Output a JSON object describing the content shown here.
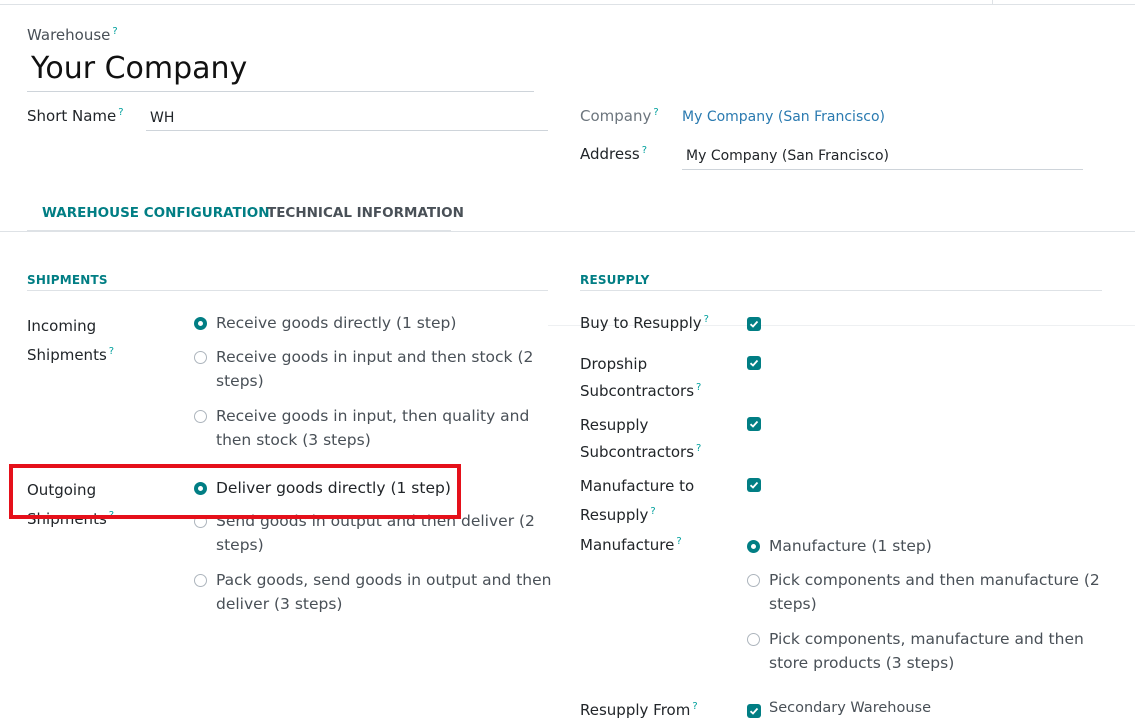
{
  "form": {
    "warehouse_label": "Warehouse",
    "help_mark": "?",
    "warehouse_name": "Your Company",
    "short_name_label": "Short Name",
    "short_name_value": "WH",
    "company_label": "Company",
    "company_value": "My Company (San Francisco)",
    "address_label": "Address",
    "address_value": "My Company (San Francisco)"
  },
  "tabs": [
    {
      "label": "WAREHOUSE CONFIGURATION",
      "active": true
    },
    {
      "label": "TECHNICAL INFORMATION",
      "active": false
    }
  ],
  "shipments": {
    "title": "SHIPMENTS",
    "incoming_label_1": "Incoming",
    "incoming_label_2": "Shipments",
    "incoming_options": [
      {
        "line1": "Receive goods directly (1 step)",
        "line2": "",
        "selected": true
      },
      {
        "line1": "Receive goods in input and then stock (2",
        "line2": "steps)",
        "selected": false
      },
      {
        "line1": "Receive goods in input, then quality and",
        "line2": "then stock (3 steps)",
        "selected": false
      }
    ],
    "outgoing_label_1": "Outgoing",
    "outgoing_label_2": "Shipments",
    "outgoing_options": [
      {
        "line1": "Deliver goods directly (1 step)",
        "line2": "",
        "selected": true
      },
      {
        "line1": "Send goods in output and then deliver (2",
        "line2": "steps)",
        "selected": false
      },
      {
        "line1": "Pack goods, send goods in output and then",
        "line2": "deliver (3 steps)",
        "selected": false
      }
    ]
  },
  "resupply": {
    "title": "RESUPPLY",
    "buy_label": "Buy to Resupply",
    "buy_checked": true,
    "dropship_label_1": "Dropship",
    "dropship_label_2": "Subcontractors",
    "dropship_checked": true,
    "resupply_sub_label_1": "Resupply",
    "resupply_sub_label_2": "Subcontractors",
    "resupply_sub_checked": true,
    "manufacture_to_label_1": "Manufacture to",
    "manufacture_to_label_2": "Resupply",
    "manufacture_to_checked": true,
    "manufacture_label": "Manufacture",
    "manufacture_options": [
      {
        "line1": "Manufacture (1 step)",
        "line2": "",
        "selected": true
      },
      {
        "line1": "Pick components and then manufacture (2",
        "line2": "steps)",
        "selected": false
      },
      {
        "line1": "Pick components, manufacture and then",
        "line2": "store products (3 steps)",
        "selected": false
      }
    ],
    "resupply_from_label": "Resupply From",
    "resupply_from_value": "Secondary Warehouse",
    "resupply_from_checked": true
  },
  "colors": {
    "accent": "#017e84",
    "help": "#00A09D",
    "highlight": "#e5101a"
  }
}
